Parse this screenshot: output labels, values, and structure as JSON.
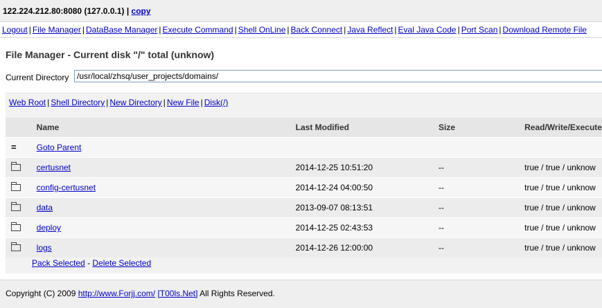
{
  "top": {
    "ip": "122.224.212.80:8080",
    "local": "(127.0.0.1)",
    "sep": "|",
    "copy": "copy"
  },
  "nav": {
    "items": [
      "Logout",
      "File Manager",
      "DataBase Manager",
      "Execute Command",
      "Shell OnLine",
      "Back Connect",
      "Java Reflect",
      "Eval Java Code",
      "Port Scan",
      "Download Remote File"
    ],
    "sep": "|"
  },
  "title": "File Manager - Current disk \"/\" total (unknow)",
  "current_dir": {
    "label": "Current Directory",
    "value": "/usr/local/zhsq/user_projects/domains/"
  },
  "quick_links": {
    "items": [
      "Web Root",
      "Shell Directory",
      "New Directory",
      "New File",
      "Disk(/)"
    ],
    "sep": "|"
  },
  "table": {
    "headers": {
      "name": "Name",
      "modified": "Last Modified",
      "size": "Size",
      "rwx": "Read/Write/Execute"
    },
    "parent": {
      "icon": "=",
      "label": "Goto Parent"
    },
    "rows": [
      {
        "name": "certusnet",
        "modified": "2014-12-25 10:51:20",
        "size": "--",
        "rwx": "true / true / unknow"
      },
      {
        "name": "config-certusnet",
        "modified": "2014-12-24 04:00:50",
        "size": "--",
        "rwx": "true / true / unknow"
      },
      {
        "name": "data",
        "modified": "2013-09-07 08:13:51",
        "size": "--",
        "rwx": "true / true / unknow"
      },
      {
        "name": "deploy",
        "modified": "2014-12-25 02:43:53",
        "size": "--",
        "rwx": "true / true / unknow"
      },
      {
        "name": "logs",
        "modified": "2014-12-26 12:00:00",
        "size": "--",
        "rwx": "true / true / unknow"
      }
    ]
  },
  "actions": {
    "pack": "Pack Selected",
    "sep": "-",
    "delete": "Delete Selected"
  },
  "footer": {
    "prefix": "Copyright (C) 2009",
    "link1": "http://www.Forjj.com/",
    "link2": "[T00ls.Net]",
    "suffix": "All Rights Reserved."
  }
}
